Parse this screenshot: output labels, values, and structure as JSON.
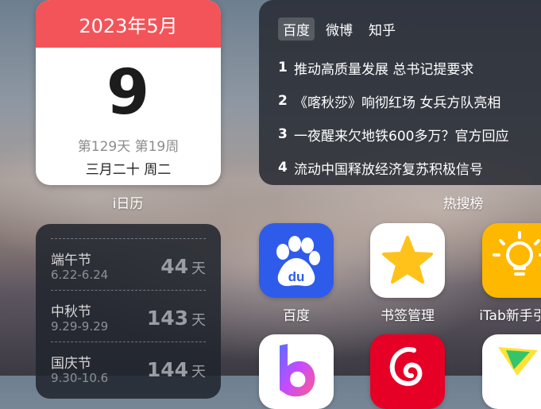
{
  "calendar": {
    "header": "2023年5月",
    "day": "9",
    "stats": "第129天 第19周",
    "lunar": "三月二十 周二",
    "label": "i日历",
    "accent_color": "#f2545a"
  },
  "hot_search": {
    "tabs": [
      {
        "label": "百度",
        "active": true
      },
      {
        "label": "微博",
        "active": false
      },
      {
        "label": "知乎",
        "active": false
      }
    ],
    "items": [
      {
        "rank": "1",
        "title": "推动高质量发展 总书记提要求"
      },
      {
        "rank": "2",
        "title": "《喀秋莎》响彻红场 女兵方队亮相"
      },
      {
        "rank": "3",
        "title": "一夜醒来欠地铁600多万？官方回应"
      },
      {
        "rank": "4",
        "title": "流动中国释放经济复苏积极信号"
      }
    ],
    "label": "热搜榜"
  },
  "countdown": {
    "unit": "天",
    "items": [
      {
        "name": "端午节",
        "date": "6.22-6.24",
        "days": "44"
      },
      {
        "name": "中秋节",
        "date": "9.29-9.29",
        "days": "143"
      },
      {
        "name": "国庆节",
        "date": "9.30-10.6",
        "days": "144"
      }
    ]
  },
  "apps": [
    {
      "label": "百度",
      "icon": "baidu-paw-icon",
      "color": "#2f5bea"
    },
    {
      "label": "书签管理",
      "icon": "star-icon",
      "color": "#ffffff"
    },
    {
      "label": "iTab新手引导",
      "icon": "lightbulb-icon",
      "color": "#ffb800"
    },
    {
      "label": "",
      "icon": "b-logo-icon",
      "color": "#ffffff"
    },
    {
      "label": "",
      "icon": "netease-music-icon",
      "color": "#e60026"
    },
    {
      "label": "",
      "icon": "green-yellow-app-icon",
      "color": "#ffffff"
    }
  ]
}
